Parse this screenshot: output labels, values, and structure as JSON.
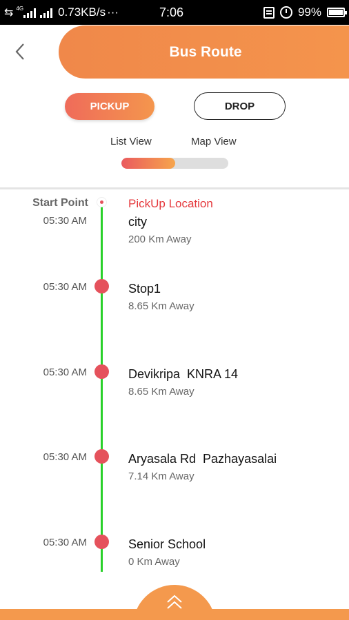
{
  "status_bar": {
    "network_type": "4G",
    "data_speed": "0.73KB/s",
    "more_indicator": "···",
    "time": "7:06",
    "battery_percent": "99%",
    "battery_level": 0.99,
    "icons": [
      "data-arrows-icon",
      "signal-icon",
      "signal-icon",
      "notification-icon",
      "alarm-icon",
      "battery-icon"
    ]
  },
  "header": {
    "title": "Bus Route",
    "back_icon": "chevron-left-icon",
    "accent_color": "#f4944c"
  },
  "route_toggle": {
    "pickup_label": "PICKUP",
    "drop_label": "DROP",
    "selected": "pickup"
  },
  "view_tabs": {
    "list_label": "List View",
    "map_label": "Map View",
    "selected": "list"
  },
  "timeline": {
    "start_label": "Start Point",
    "pickup_label": "PickUp Location",
    "line_color": "#29d12a",
    "dot_color": "#e5525c",
    "stops": [
      {
        "time": "05:30 AM",
        "name": "city",
        "distance": "200 Km Away"
      },
      {
        "time": "05:30 AM",
        "name": "Stop1",
        "distance": "8.65 Km Away"
      },
      {
        "time": "05:30 AM",
        "name": "Devikripa  KNRA 14",
        "distance": "8.65 Km Away"
      },
      {
        "time": "05:30 AM",
        "name": "Aryasala Rd  Pazhayasalai",
        "distance": "7.14 Km Away"
      },
      {
        "time": "05:30 AM",
        "name": "Senior School",
        "distance": "0 Km Away"
      }
    ]
  },
  "bottom_sheet": {
    "icon": "double-chevron-up-icon"
  }
}
